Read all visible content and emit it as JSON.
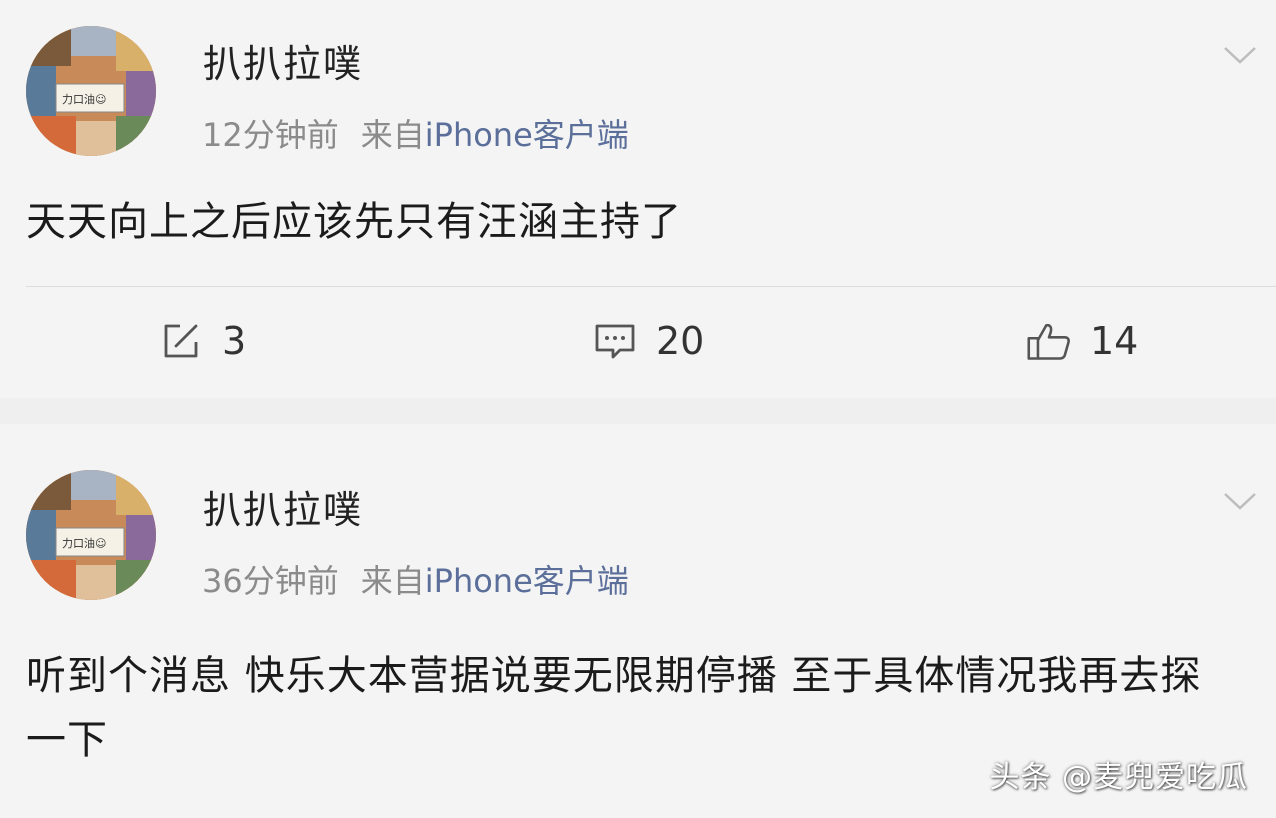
{
  "posts": [
    {
      "username": "扒扒拉噗",
      "time": "12分钟前",
      "source_label": "来自",
      "client": "iPhone客户端",
      "text": "天天向上之后应该先只有汪涵主持了",
      "actions": {
        "repost_count": "3",
        "comment_count": "20",
        "like_count": "14"
      }
    },
    {
      "username": "扒扒拉噗",
      "time": "36分钟前",
      "source_label": "来自",
      "client": "iPhone客户端",
      "text": "听到个消息 快乐大本营据说要无限期停播 至于具体情况我再去探一下"
    }
  ],
  "watermark": "头条 @麦兜爱吃瓜",
  "icons": {
    "repost": "edit-square-icon",
    "comment": "comment-bubble-icon",
    "like": "thumbs-up-icon",
    "menu": "chevron-down-icon"
  },
  "colors": {
    "background": "#efefef",
    "card": "#f4f4f4",
    "meta_text": "#8b8b8b",
    "client_link": "#5b6f9a"
  }
}
